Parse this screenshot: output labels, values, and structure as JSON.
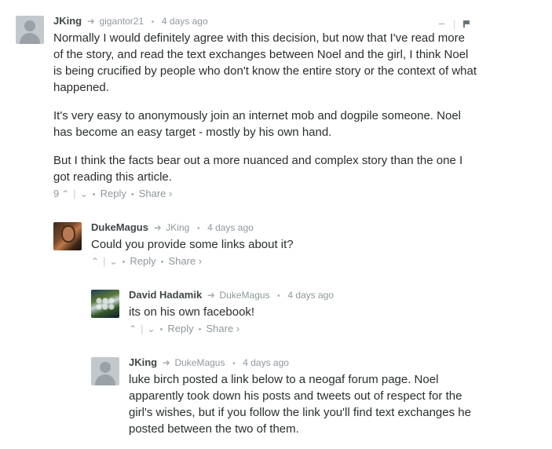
{
  "comments": [
    {
      "author": "JKing",
      "reply_to": "gigantor21",
      "time": "4 days ago",
      "paragraphs": [
        "Normally I would definitely agree with this decision, but now that I've read more of the story, and read the text exchanges between Noel and the girl, I think Noel is being crucified by people who don't know the entire story or the context of what happened.",
        "It's very easy to anonymously join an internet mob and dogpile someone. Noel has become an easy target - mostly by his own hand.",
        "But I think the facts bear out a more nuanced and complex story than the one I got reading this article."
      ],
      "votes": "9",
      "reply_label": "Reply",
      "share_label": "Share ›",
      "collapse_label": "–"
    },
    {
      "author": "DukeMagus",
      "reply_to": "JKing",
      "time": "4 days ago",
      "text": "Could you provide some links about it?",
      "reply_label": "Reply",
      "share_label": "Share ›"
    },
    {
      "author": "David Hadamik",
      "reply_to": "DukeMagus",
      "time": "4 days ago",
      "text": "its on his own facebook!",
      "reply_label": "Reply",
      "share_label": "Share ›"
    },
    {
      "author": "JKing",
      "reply_to": "DukeMagus",
      "time": "4 days ago",
      "text": "luke birch posted a link below to a neogaf forum page. Noel apparently took down his posts and tweets out of respect for the girl's wishes, but if you follow the link you'll find text exchanges he posted between the two of them."
    }
  ],
  "icons": {
    "reply_arrow": "➜",
    "upvote": "⌃",
    "downvote": "⌄",
    "bullet": "•"
  }
}
